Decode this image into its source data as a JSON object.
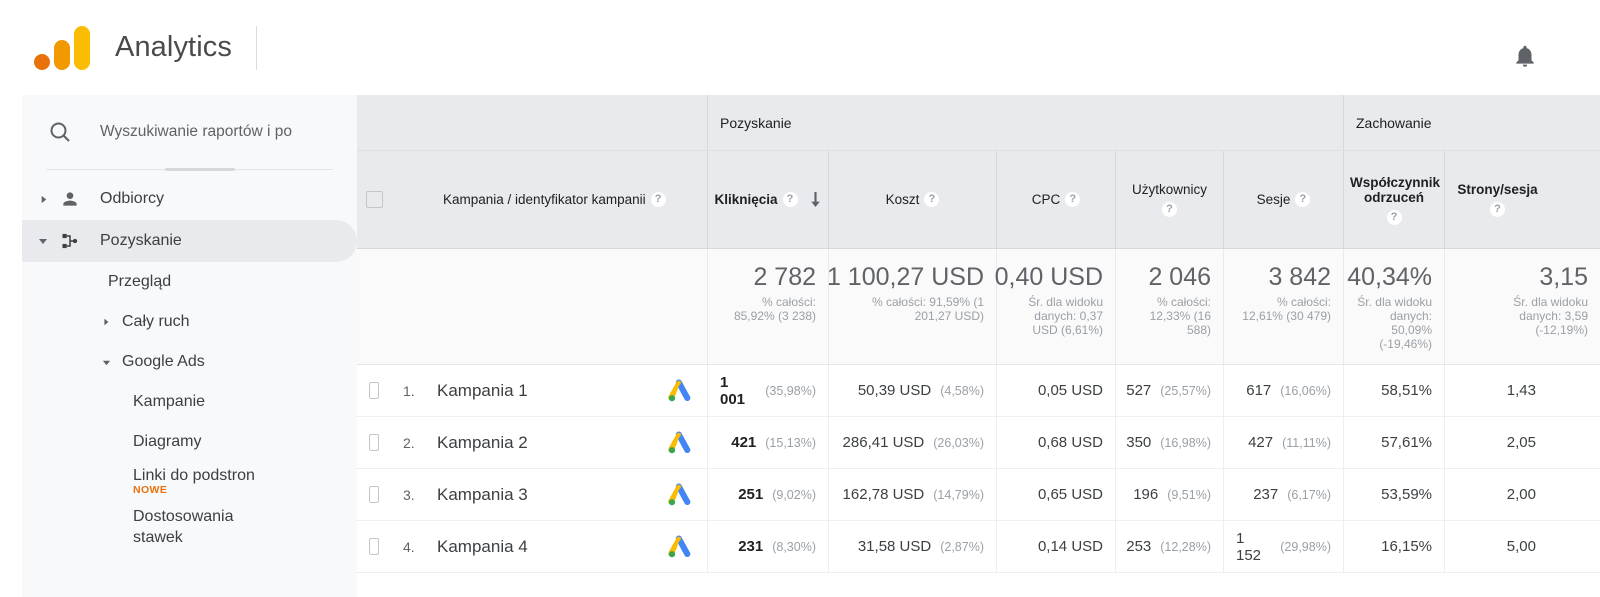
{
  "app": {
    "brand": "Analytics",
    "logo_colors": {
      "dot": "#e8710a",
      "mid": "#f29900",
      "tall": "#fbbc04"
    },
    "notifications_icon": "bell-icon"
  },
  "search": {
    "placeholder": "Wyszukiwanie raportów i po",
    "value": "",
    "icon": "search-icon"
  },
  "sidebar": {
    "items": [
      {
        "label": "Odbiorcy",
        "icon": "person-icon",
        "caret": "collapsed",
        "state": "default"
      },
      {
        "label": "Pozyskanie",
        "icon": "acquisition-node-icon",
        "caret": "expanded",
        "state": "selected"
      }
    ],
    "sub_items": [
      {
        "label": "Przegląd",
        "caret": "none",
        "state": "default"
      },
      {
        "label": "Cały ruch",
        "caret": "collapsed",
        "state": "default"
      },
      {
        "label": "Google Ads",
        "caret": "expanded",
        "state": "selected"
      }
    ],
    "leaf_items": [
      {
        "label": "Kampanie",
        "state": "active",
        "badge": ""
      },
      {
        "label": "Diagramy",
        "state": "default",
        "badge": ""
      },
      {
        "label": "Linki do podstron",
        "state": "default",
        "badge": "NOWE"
      },
      {
        "label": "Dostosowania stawek",
        "state": "default",
        "badge": ""
      }
    ],
    "active_color": "#1a73e8",
    "badge_color": "#e8710a"
  },
  "table": {
    "group_headers": [
      {
        "label": "Pozyskanie",
        "span_cols": 5
      },
      {
        "label": "Zachowanie",
        "span_cols": 2
      }
    ],
    "dimension_header": {
      "label": "Kampania / identyfikator kampanii",
      "help": "?"
    },
    "columns": [
      {
        "label": "Kliknięcia",
        "help": "?",
        "sorted": "desc",
        "bold": true
      },
      {
        "label": "Koszt",
        "help": "?",
        "sorted": "",
        "bold": false
      },
      {
        "label": "CPC",
        "help": "?",
        "sorted": "",
        "bold": false
      },
      {
        "label": "Użytkownicy",
        "help": "?",
        "sorted": "",
        "bold": false
      },
      {
        "label": "Sesje",
        "help": "?",
        "sorted": "",
        "bold": false
      },
      {
        "label": "Współczynnik odrzuceń",
        "help": "?",
        "sorted": "",
        "bold": false
      },
      {
        "label": "Strony/sesja",
        "help": "?",
        "sorted": "",
        "bold": false
      }
    ],
    "summary": [
      {
        "main": "2 782",
        "sub": "% całości: 85,92% (3 238)"
      },
      {
        "main": "1 100,27 USD",
        "sub": "% całości: 91,59% (1 201,27 USD)"
      },
      {
        "main": "0,40 USD",
        "sub": "Śr. dla widoku danych: 0,37 USD (6,61%)"
      },
      {
        "main": "2 046",
        "sub": "% całości: 12,33% (16 588)"
      },
      {
        "main": "3 842",
        "sub": "% całości: 12,61% (30 479)"
      },
      {
        "main": "40,34%",
        "sub": "Śr. dla widoku danych: 50,09% (-19,46%)"
      },
      {
        "main": "3,15",
        "sub": "Śr. dla widoku danych: 3,59 (-12,19%)"
      }
    ],
    "rows": [
      {
        "rank": "1.",
        "name": "Kampania 1",
        "icon": "google-ads-icon",
        "clicks": "1 001",
        "clicks_pct": "(35,98%)",
        "cost": "50,39 USD",
        "cost_pct": "(4,58%)",
        "cpc": "0,05 USD",
        "users": "527",
        "users_pct": "(25,57%)",
        "sessions": "617",
        "sessions_pct": "(16,06%)",
        "bounce": "58,51%",
        "pages": "1,43"
      },
      {
        "rank": "2.",
        "name": "Kampania 2",
        "icon": "google-ads-icon",
        "clicks": "421",
        "clicks_pct": "(15,13%)",
        "cost": "286,41 USD",
        "cost_pct": "(26,03%)",
        "cpc": "0,68 USD",
        "users": "350",
        "users_pct": "(16,98%)",
        "sessions": "427",
        "sessions_pct": "(11,11%)",
        "bounce": "57,61%",
        "pages": "2,05"
      },
      {
        "rank": "3.",
        "name": "Kampania 3",
        "icon": "google-ads-icon",
        "clicks": "251",
        "clicks_pct": "(9,02%)",
        "cost": "162,78 USD",
        "cost_pct": "(14,79%)",
        "cpc": "0,65 USD",
        "users": "196",
        "users_pct": "(9,51%)",
        "sessions": "237",
        "sessions_pct": "(6,17%)",
        "bounce": "53,59%",
        "pages": "2,00"
      },
      {
        "rank": "4.",
        "name": "Kampania 4",
        "icon": "google-ads-icon",
        "clicks": "231",
        "clicks_pct": "(8,30%)",
        "cost": "31,58 USD",
        "cost_pct": "(2,87%)",
        "cpc": "0,14 USD",
        "users": "253",
        "users_pct": "(12,28%)",
        "sessions": "1 152",
        "sessions_pct": "(29,98%)",
        "bounce": "16,15%",
        "pages": "5,00"
      }
    ]
  }
}
